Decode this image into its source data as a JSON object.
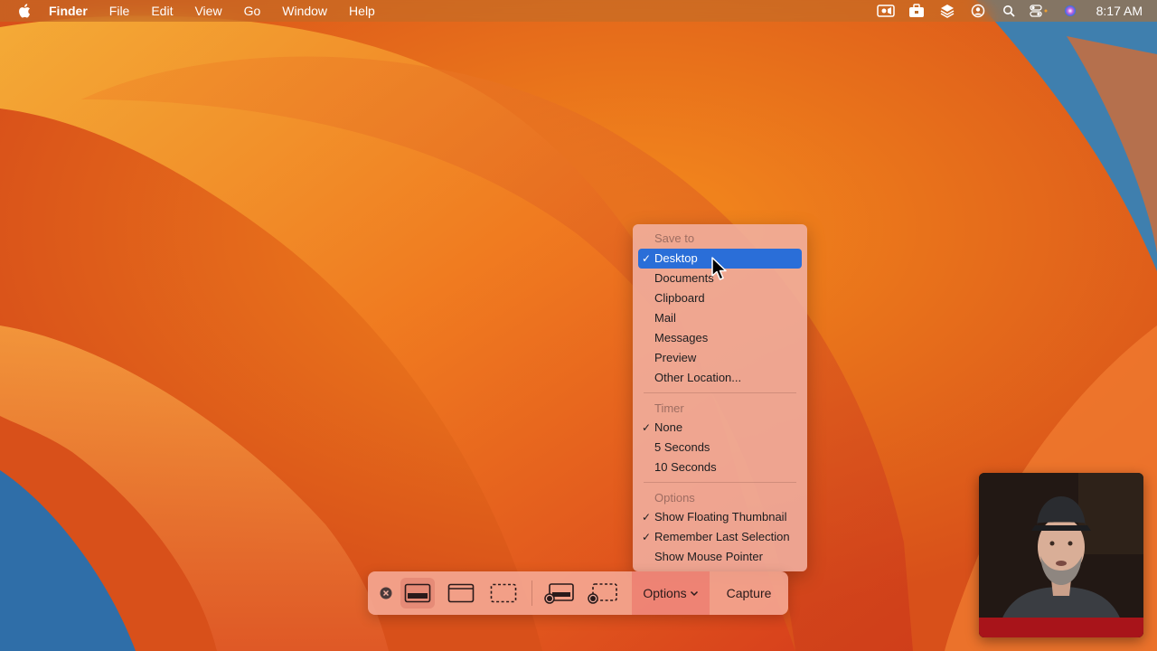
{
  "menubar": {
    "app_name": "Finder",
    "menus": [
      "File",
      "Edit",
      "View",
      "Go",
      "Window",
      "Help"
    ],
    "status_icons": [
      "video-recorder-icon",
      "toolbox-icon",
      "layers-icon",
      "user-circle-icon",
      "search-icon",
      "control-center-icon",
      "siri-icon"
    ],
    "clock": "8:17 AM"
  },
  "options_menu": {
    "save_to": {
      "heading": "Save to",
      "items": [
        {
          "label": "Desktop",
          "checked": true,
          "highlighted": true
        },
        {
          "label": "Documents",
          "checked": false
        },
        {
          "label": "Clipboard",
          "checked": false
        },
        {
          "label": "Mail",
          "checked": false
        },
        {
          "label": "Messages",
          "checked": false
        },
        {
          "label": "Preview",
          "checked": false
        },
        {
          "label": "Other Location...",
          "checked": false
        }
      ]
    },
    "timer": {
      "heading": "Timer",
      "items": [
        {
          "label": "None",
          "checked": true
        },
        {
          "label": "5 Seconds",
          "checked": false
        },
        {
          "label": "10 Seconds",
          "checked": false
        }
      ]
    },
    "options": {
      "heading": "Options",
      "items": [
        {
          "label": "Show Floating Thumbnail",
          "checked": true
        },
        {
          "label": "Remember Last Selection",
          "checked": true
        },
        {
          "label": "Show Mouse Pointer",
          "checked": false
        }
      ]
    },
    "checkmark": "✓"
  },
  "toolbar": {
    "options_label": "Options",
    "capture_label": "Capture",
    "colors": {
      "highlight": "#2a6ed8",
      "close": "#4a3a3a"
    }
  }
}
